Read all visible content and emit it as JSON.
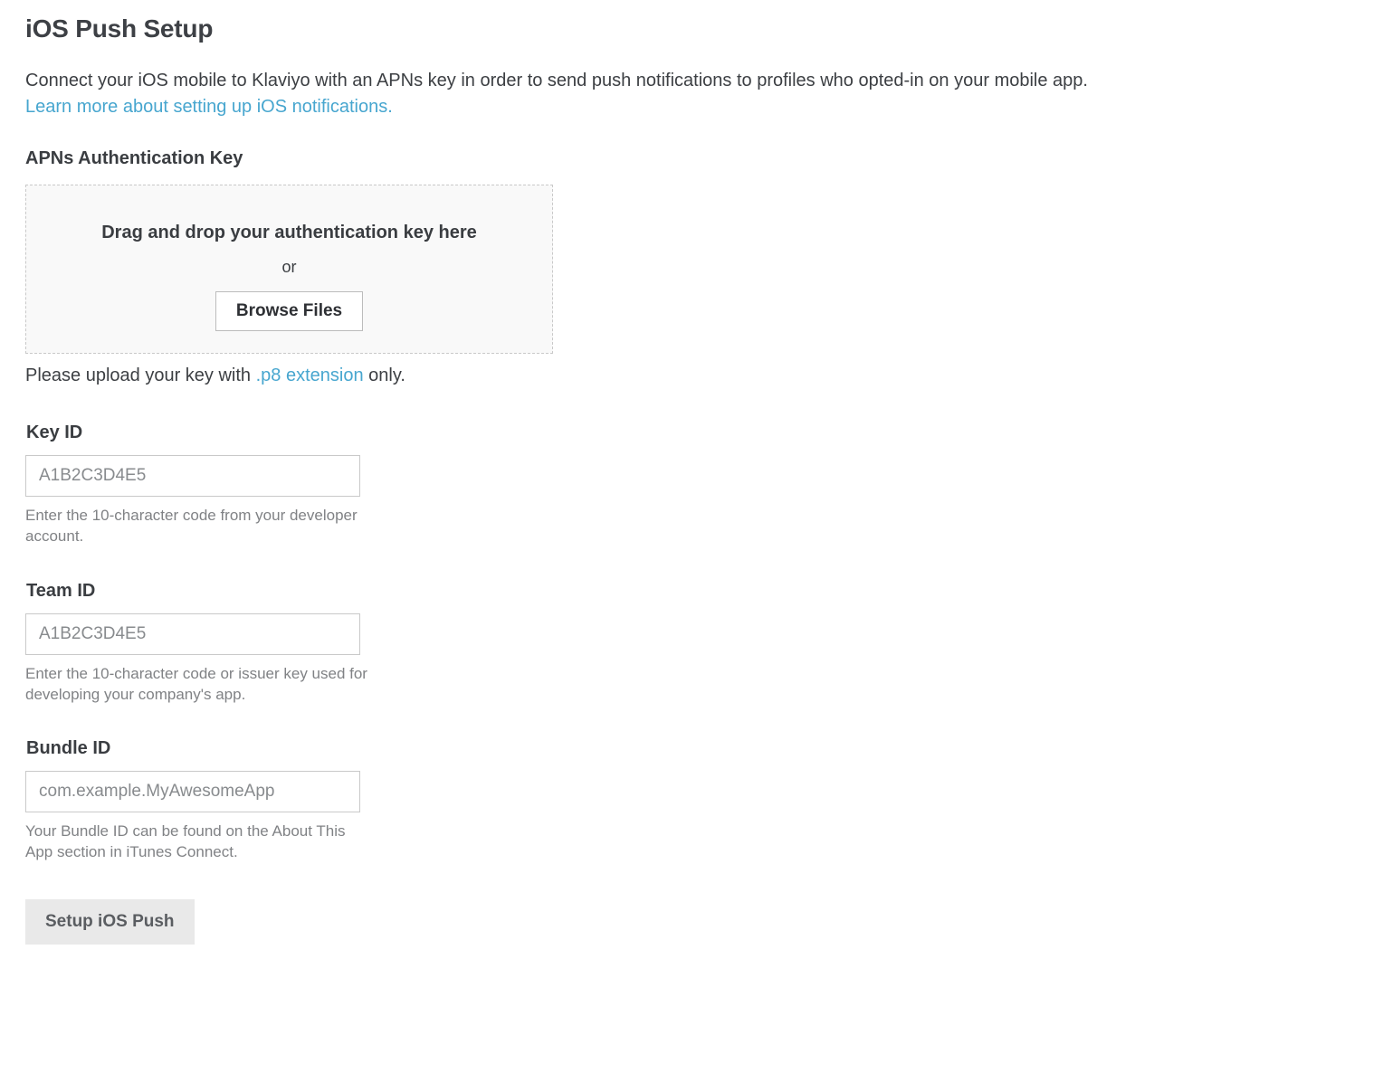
{
  "title": "iOS Push Setup",
  "intro": {
    "text": "Connect your iOS mobile to Klaviyo with an APNs key in order to send push notifications to profiles who opted-in on your mobile app.",
    "link_text": "Learn more about setting up iOS notifications."
  },
  "auth_key": {
    "heading": "APNs Authentication Key",
    "drag_text": "Drag and drop your authentication key here",
    "or_text": "or",
    "browse_label": "Browse Files",
    "hint_before": "Please upload your key with ",
    "hint_link": ".p8 extension",
    "hint_after": " only."
  },
  "key_id": {
    "label": "Key ID",
    "placeholder": "A1B2C3D4E5",
    "value": "",
    "help": "Enter the 10-character code from your developer account."
  },
  "team_id": {
    "label": "Team ID",
    "placeholder": "A1B2C3D4E5",
    "value": "",
    "help": "Enter the 10-character code or issuer key used for developing your company's app."
  },
  "bundle_id": {
    "label": "Bundle ID",
    "placeholder": "com.example.MyAwesomeApp",
    "value": "",
    "help": "Your Bundle ID can be found on the About This App section in iTunes Connect."
  },
  "submit_label": "Setup iOS Push"
}
